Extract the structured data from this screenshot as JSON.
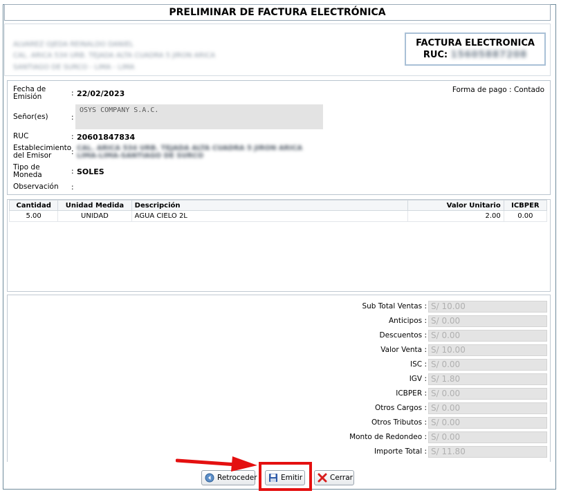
{
  "window": {
    "title": "PRELIMINAR DE FACTURA ELECTRÓNICA"
  },
  "emitter": {
    "name": "ALVAREZ OJEDA REINALDO DANIEL",
    "address_line1": "CAL. ARICA 534 URB. TEJADA ALTA CUADRA 5 JIRON ARICA",
    "address_line2": "SANTIAGO DE SURCO - LIMA - LIMA",
    "doc_type": "FACTURA ELECTRONICA",
    "ruc_label": "RUC:",
    "ruc_value": "15605887208"
  },
  "header": {
    "fecha_label": "Fecha de Emisión",
    "fecha_value": "22/02/2023",
    "senor_label": "Señor(es)",
    "senor_value": "OSYS COMPANY S.A.C.",
    "ruc_label": "RUC",
    "ruc_value": "20601847834",
    "establecimiento_label": "Establecimiento del Emisor",
    "establecimiento_line1": "CAL. ARICA 534 URB. TEJADA ALTA CUADRA 5 JIRON ARICA",
    "establecimiento_line2": "LIMA-LIMA-SANTIAGO DE SURCO",
    "moneda_label": "Tipo de Moneda",
    "moneda_value": "SOLES",
    "observacion_label": "Observación",
    "observacion_value": "",
    "forma_pago_label": "Forma de pago",
    "forma_pago_value": "Contado",
    "colon": ":"
  },
  "items": {
    "columns": [
      "Cantidad",
      "Unidad Medida",
      "Descripción",
      "Valor Unitario",
      "ICBPER"
    ],
    "rows": [
      [
        "5.00",
        "UNIDAD",
        "AGUA CIELO 2L",
        "2.00",
        "0.00"
      ]
    ]
  },
  "totals": [
    {
      "label": "Sub Total Ventas :",
      "value": "S/ 10.00"
    },
    {
      "label": "Anticipos :",
      "value": "S/ 0.00"
    },
    {
      "label": "Descuentos :",
      "value": "S/ 0.00"
    },
    {
      "label": "Valor Venta :",
      "value": "S/ 10.00"
    },
    {
      "label": "ISC :",
      "value": "S/ 0.00"
    },
    {
      "label": "IGV :",
      "value": "S/ 1.80"
    },
    {
      "label": "ICBPER :",
      "value": "S/ 0.00"
    },
    {
      "label": "Otros Cargos :",
      "value": "S/ 0.00"
    },
    {
      "label": "Otros Tributos :",
      "value": "S/ 0.00"
    },
    {
      "label": "Monto de Redondeo :",
      "value": "S/ 0.00"
    },
    {
      "label": "Importe Total :",
      "value": "S/ 11.80"
    }
  ],
  "buttons": {
    "retroceder": "Retroceder",
    "emitir": "Emitir",
    "cerrar": "Cerrar"
  },
  "colors": {
    "highlight": "#e41010",
    "field_bg": "#e4e4e4"
  }
}
